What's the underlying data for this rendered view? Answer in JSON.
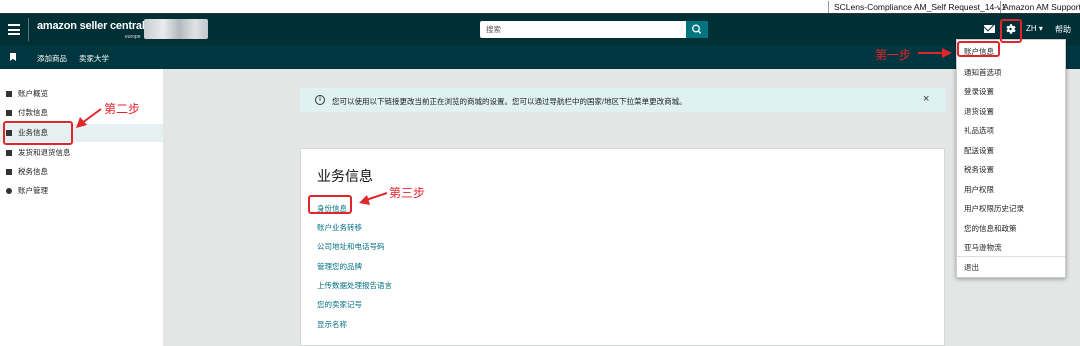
{
  "top_strip": {
    "account_1": "SCLens-Compliance AM_Self Request_14-v1",
    "account_2": "Amazon AM Support"
  },
  "header": {
    "logo_text": "amazon seller central",
    "logo_sub": "europe",
    "search_placeholder": "搜索",
    "language": "ZH ▾",
    "help": "帮助"
  },
  "navbar": {
    "items": [
      "添加商品",
      "卖家大学"
    ]
  },
  "sidebar": {
    "items": [
      {
        "label": "账户概览"
      },
      {
        "label": "付款信息"
      },
      {
        "label": "业务信息"
      },
      {
        "label": "发货和退货信息"
      },
      {
        "label": "税务信息"
      },
      {
        "label": "账户管理"
      }
    ]
  },
  "banner": {
    "message": "您可以使用以下链接更改当前正在浏览的商城的设置。您可以通过导航栏中的国家/地区下拉菜单更改商城。",
    "close": "×"
  },
  "card": {
    "title": "业务信息",
    "links": [
      "身份信息",
      "账户业务转移",
      "公司地址和电话号码",
      "管理您的品牌",
      "上传数据处理报告语言",
      "您的卖家记号",
      "显示名称"
    ]
  },
  "dropdown": {
    "items": [
      "账户信息",
      "通知首选项",
      "登录设置",
      "退货设置",
      "礼品选项",
      "配送设置",
      "税务设置",
      "用户权限",
      "用户权限历史记录",
      "您的信息和政策",
      "亚马逊物流"
    ],
    "logout": "退出"
  },
  "annotations": {
    "step1": "第一步",
    "step2": "第二步",
    "step3": "第三步"
  },
  "colors": {
    "header_bg": "#002f36",
    "nav_bg": "#00363f",
    "link": "#007185",
    "annotation_red": "#e0262b",
    "banner_bg": "#dff1f3"
  }
}
